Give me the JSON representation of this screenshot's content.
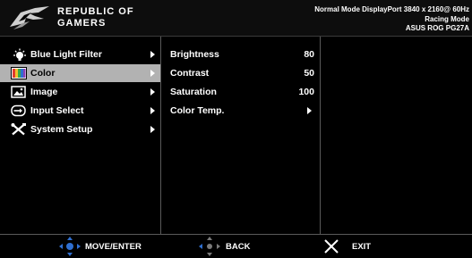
{
  "header": {
    "brand_line1": "REPUBLIC OF",
    "brand_line2": "GAMERS",
    "status_line1": "Normal Mode DisplayPort 3840 x 2160@ 60Hz",
    "status_line2": "Racing Mode",
    "status_line3": "ASUS ROG PG27A"
  },
  "main_menu": {
    "items": [
      {
        "label": "Blue Light Filter",
        "icon": "light-bulb-icon"
      },
      {
        "label": "Color",
        "icon": "color-palette-icon",
        "selected": true
      },
      {
        "label": "Image",
        "icon": "image-icon"
      },
      {
        "label": "Input Select",
        "icon": "input-select-icon"
      },
      {
        "label": "System Setup",
        "icon": "wrench-screwdriver-icon"
      }
    ]
  },
  "sub_menu": {
    "items": [
      {
        "label": "Brightness",
        "value": "80"
      },
      {
        "label": "Contrast",
        "value": "50"
      },
      {
        "label": "Saturation",
        "value": "100"
      },
      {
        "label": "Color Temp.",
        "value": ""
      }
    ]
  },
  "footer": {
    "move_label": "MOVE/ENTER",
    "back_label": "BACK",
    "exit_label": "EXIT"
  },
  "colors": {
    "background": "#000000",
    "selected_row": "#b2b2b2",
    "nav_icon_blue": "#2f6fd0",
    "exit_icon_white": "#ffffff"
  }
}
